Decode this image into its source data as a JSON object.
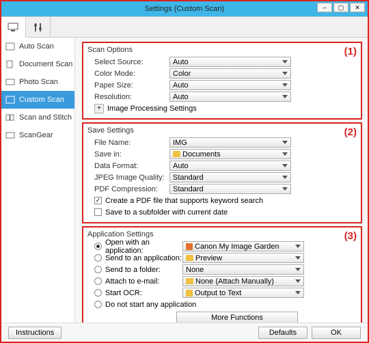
{
  "window": {
    "title": "Settings (Custom Scan)"
  },
  "sidebar": {
    "items": [
      {
        "label": "Auto Scan"
      },
      {
        "label": "Document Scan"
      },
      {
        "label": "Photo Scan"
      },
      {
        "label": "Custom Scan"
      },
      {
        "label": "Scan and Stitch"
      },
      {
        "label": "ScanGear"
      }
    ]
  },
  "callouts": {
    "g1": "(1)",
    "g2": "(2)",
    "g3": "(3)"
  },
  "scan": {
    "title": "Scan Options",
    "select_source_label": "Select Source:",
    "select_source_value": "Auto",
    "color_mode_label": "Color Mode:",
    "color_mode_value": "Color",
    "paper_size_label": "Paper Size:",
    "paper_size_value": "Auto",
    "resolution_label": "Resolution:",
    "resolution_value": "Auto",
    "image_processing_label": "Image Processing Settings"
  },
  "save": {
    "title": "Save Settings",
    "file_name_label": "File Name:",
    "file_name_value": "IMG",
    "save_in_label": "Save in:",
    "save_in_value": "Documents",
    "data_format_label": "Data Format:",
    "data_format_value": "Auto",
    "jpeg_label": "JPEG Image Quality:",
    "jpeg_value": "Standard",
    "pdf_label": "PDF Compression:",
    "pdf_value": "Standard",
    "pdf_keyword_label": "Create a PDF file that supports keyword search",
    "subfolder_label": "Save to a subfolder with current date"
  },
  "app": {
    "title": "Application Settings",
    "open_with_label": "Open with an application:",
    "open_with_value": "Canon My Image Garden",
    "send_app_label": "Send to an application:",
    "send_app_value": "Preview",
    "send_folder_label": "Send to a folder:",
    "send_folder_value": "None",
    "attach_label": "Attach to e-mail:",
    "attach_value": "None (Attach Manually)",
    "ocr_label": "Start OCR:",
    "ocr_value": "Output to Text",
    "none_label": "Do not start any application",
    "more_functions": "More Functions"
  },
  "footer": {
    "instructions": "Instructions",
    "defaults": "Defaults",
    "ok": "OK"
  }
}
